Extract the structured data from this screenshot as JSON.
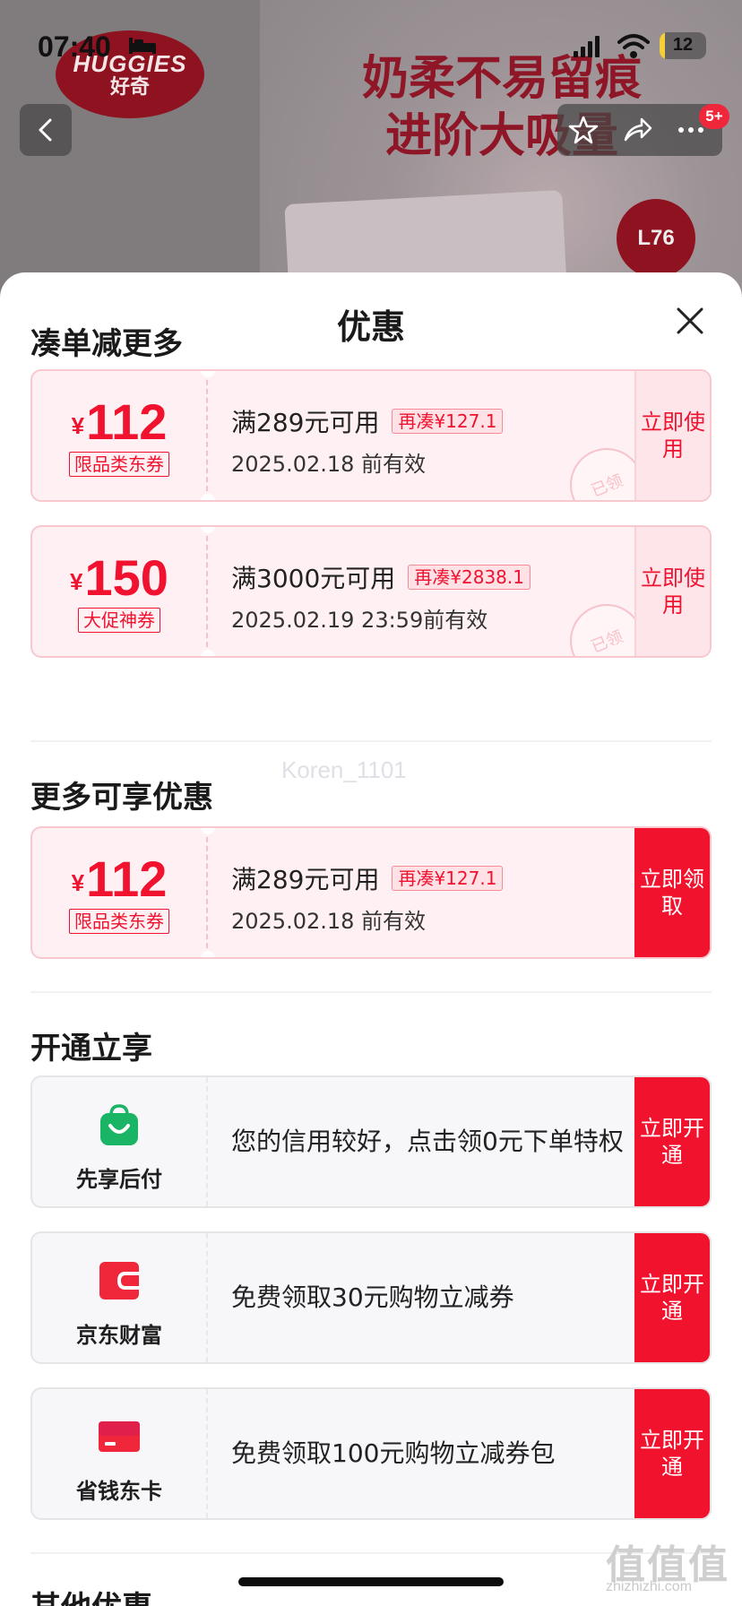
{
  "status_bar": {
    "time": "07:40",
    "battery": "12",
    "battery_level": 0.12
  },
  "banner": {
    "logo_en": "HUGGIES",
    "logo_cn": "好奇",
    "slogan_line1": "奶柔不易留痕",
    "slogan_line2": "进阶大吸量",
    "size_badge": "L76",
    "notification_count": "5+"
  },
  "sheet": {
    "title": "优惠",
    "watermark": "Koren_1101",
    "sections": {
      "bundle": "凑单减更多",
      "more": "更多可享优惠",
      "open": "开通立享",
      "other": "其他优惠"
    },
    "bundle_coupons": [
      {
        "currency": "¥",
        "amount": "112",
        "tag": "限品类东券",
        "condition": "满289元可用",
        "extra": "再凑¥127.1",
        "valid": "2025.02.18 前有效",
        "action": "立即使用",
        "stamp": "已领"
      },
      {
        "currency": "¥",
        "amount": "150",
        "tag": "大促神券",
        "condition": "满3000元可用",
        "extra": "再凑¥2838.1",
        "valid": "2025.02.19 23:59前有效",
        "action": "立即使用",
        "stamp": "已领"
      }
    ],
    "more_coupons": [
      {
        "currency": "¥",
        "amount": "112",
        "tag": "限品类东券",
        "condition": "满289元可用",
        "extra": "再凑¥127.1",
        "valid": "2025.02.18 前有效",
        "action": "立即领取"
      }
    ],
    "services": [
      {
        "name": "先享后付",
        "icon": "shopping-bag-icon",
        "text": "您的信用较好，点击领0元下单特权",
        "action": "立即开通"
      },
      {
        "name": "京东财富",
        "icon": "wallet-icon",
        "text": "免费领取30元购物立减券",
        "action": "立即开通"
      },
      {
        "name": "省钱东卡",
        "icon": "card-icon",
        "text": "免费领取100元购物立减券包",
        "action": "立即开通"
      }
    ]
  },
  "site_watermark": {
    "mark": "值值值",
    "url": "zhizhizhi.com"
  },
  "colors": {
    "accent": "#f0122e",
    "coupon_bg": "#fff1f3",
    "green": "#19b464"
  }
}
